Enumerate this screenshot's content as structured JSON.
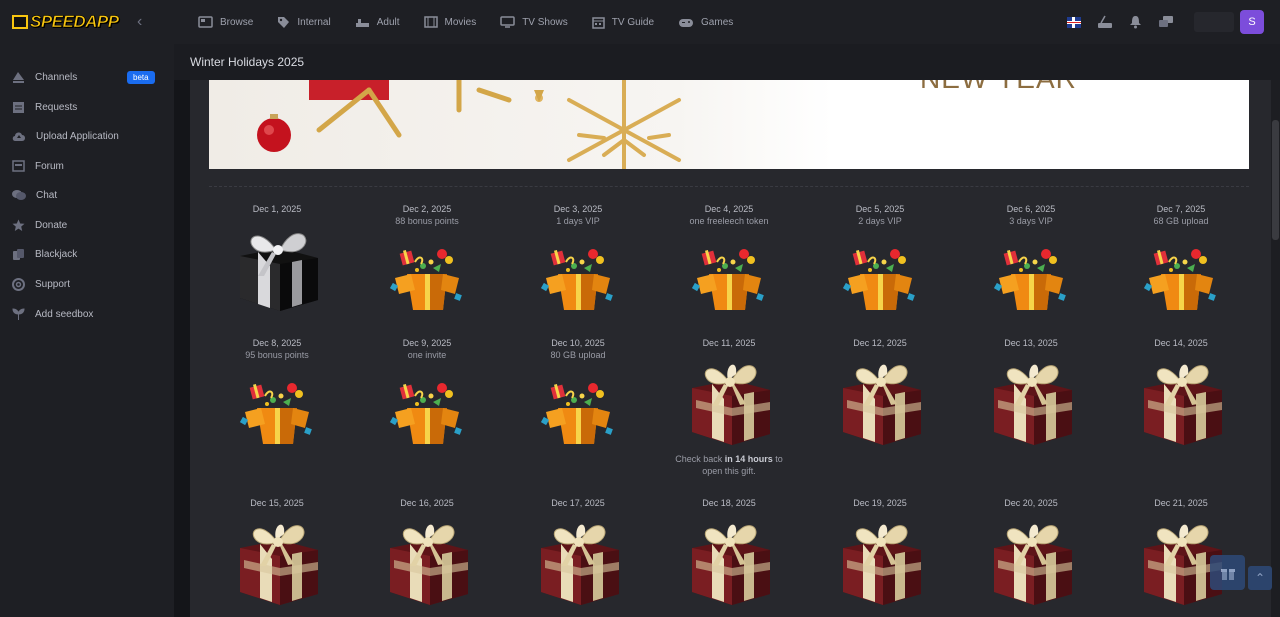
{
  "app": {
    "logo_text": "SPEEDAPP",
    "collapse_icon": "chevron-left-icon"
  },
  "nav": [
    {
      "label": "Browse",
      "icon": "browse-icon"
    },
    {
      "label": "Internal",
      "icon": "tag-icon"
    },
    {
      "label": "Adult",
      "icon": "adult-icon"
    },
    {
      "label": "Movies",
      "icon": "film-icon"
    },
    {
      "label": "TV Shows",
      "icon": "tv-icon"
    },
    {
      "label": "TV Guide",
      "icon": "calendar-icon"
    },
    {
      "label": "Games",
      "icon": "gamepad-icon"
    }
  ],
  "tools": {
    "language_icon": "uk-flag-icon",
    "avatar_letter": "S"
  },
  "sidebar": {
    "items": [
      {
        "label": "Channels",
        "badge": "beta"
      },
      {
        "label": "Requests"
      },
      {
        "label": "Upload Application"
      },
      {
        "label": "Forum"
      },
      {
        "label": "Chat"
      },
      {
        "label": "Donate"
      },
      {
        "label": "Blackjack"
      },
      {
        "label": "Support"
      },
      {
        "label": "Add seedbox"
      }
    ]
  },
  "page": {
    "title": "Winter Holidays 2025",
    "banner_text": "NEW YEAR"
  },
  "calendar": [
    {
      "date": "Dec 1, 2025",
      "reward": "",
      "state": "opened-empty"
    },
    {
      "date": "Dec 2, 2025",
      "reward": "88 bonus points",
      "state": "opened"
    },
    {
      "date": "Dec 3, 2025",
      "reward": "1 days VIP",
      "state": "opened"
    },
    {
      "date": "Dec 4, 2025",
      "reward": "one freeleech token",
      "state": "opened"
    },
    {
      "date": "Dec 5, 2025",
      "reward": "2 days VIP",
      "state": "opened"
    },
    {
      "date": "Dec 6, 2025",
      "reward": "3 days VIP",
      "state": "opened"
    },
    {
      "date": "Dec 7, 2025",
      "reward": "68 GB upload",
      "state": "opened"
    },
    {
      "date": "Dec 8, 2025",
      "reward": "95 bonus points",
      "state": "opened"
    },
    {
      "date": "Dec 9, 2025",
      "reward": "one invite",
      "state": "opened"
    },
    {
      "date": "Dec 10, 2025",
      "reward": "80 GB upload",
      "state": "opened"
    },
    {
      "date": "Dec 11, 2025",
      "reward": "",
      "state": "next",
      "countdown_pre": "Check back ",
      "countdown_bold": "in 14 hours",
      "countdown_post": " to open this gift."
    },
    {
      "date": "Dec 12, 2025",
      "reward": "",
      "state": "locked"
    },
    {
      "date": "Dec 13, 2025",
      "reward": "",
      "state": "locked"
    },
    {
      "date": "Dec 14, 2025",
      "reward": "",
      "state": "locked"
    },
    {
      "date": "Dec 15, 2025",
      "reward": "",
      "state": "locked"
    },
    {
      "date": "Dec 16, 2025",
      "reward": "",
      "state": "locked"
    },
    {
      "date": "Dec 17, 2025",
      "reward": "",
      "state": "locked"
    },
    {
      "date": "Dec 18, 2025",
      "reward": "",
      "state": "locked"
    },
    {
      "date": "Dec 19, 2025",
      "reward": "",
      "state": "locked"
    },
    {
      "date": "Dec 20, 2025",
      "reward": "",
      "state": "locked"
    },
    {
      "date": "Dec 21, 2025",
      "reward": "",
      "state": "locked"
    }
  ],
  "colors": {
    "accent": "#7c4ddb",
    "badge": "#1a6cf0",
    "gift_red": "#7a1e22",
    "ribbon": "#e9dcb8",
    "open_box": "#f08a12"
  }
}
